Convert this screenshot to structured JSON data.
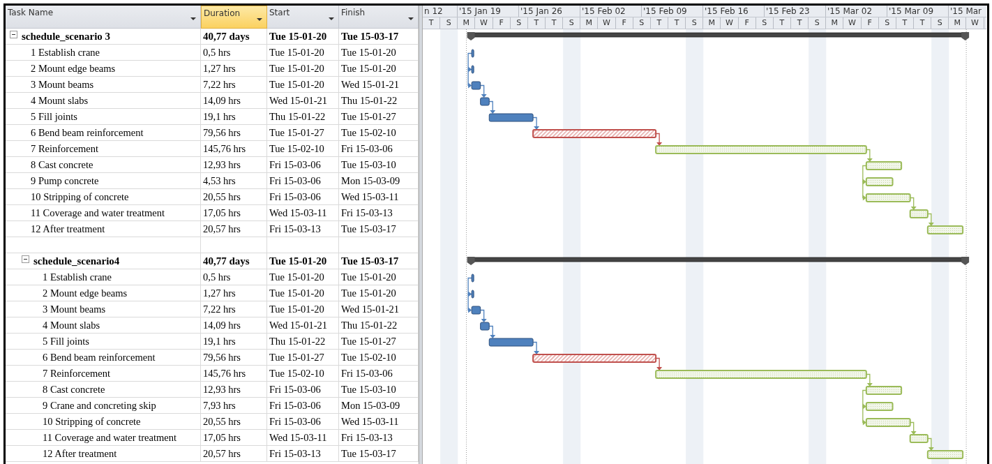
{
  "columns": [
    {
      "label": "Task Name",
      "selected": false
    },
    {
      "label": "Duration",
      "selected": true
    },
    {
      "label": "Start",
      "selected": false
    },
    {
      "label": "Finish",
      "selected": false
    }
  ],
  "timescale": {
    "weeks": [
      "n 12",
      "'15 Jan 19",
      "'15 Jan 26",
      "'15 Feb 02",
      "'15 Feb 09",
      "'15 Feb 16",
      "'15 Feb 23",
      "'15 Mar 02",
      "'15 Mar 09",
      "'15 Mar"
    ],
    "days": [
      "T",
      "S",
      "M",
      "W",
      "F",
      "S",
      "T",
      "T",
      "S",
      "M",
      "W",
      "F",
      "S",
      "T",
      "T",
      "S",
      "M",
      "W",
      "F",
      "S",
      "T",
      "T",
      "S",
      "M",
      "W",
      "F",
      "S",
      "T",
      "T",
      "S",
      "M",
      "W"
    ]
  },
  "groups": [
    {
      "name": "schedule_scenario 3",
      "expanded": true,
      "duration": "40,77 days",
      "start": "Tue 15-01-20",
      "finish": "Tue 15-03-17",
      "tasks": [
        {
          "name": "1 Establish crane",
          "duration": "0,5 hrs",
          "start": "Tue 15-01-20",
          "finish": "Tue 15-01-20",
          "kind": "solid",
          "color": "#4f81bd"
        },
        {
          "name": "2 Mount edge beams",
          "duration": "1,27 hrs",
          "start": "Tue 15-01-20",
          "finish": "Tue 15-01-20",
          "kind": "solid",
          "color": "#4f81bd"
        },
        {
          "name": "3 Mount beams",
          "duration": "7,22 hrs",
          "start": "Tue 15-01-20",
          "finish": "Wed 15-01-21",
          "kind": "solid",
          "color": "#4f81bd"
        },
        {
          "name": "4 Mount slabs",
          "duration": "14,09 hrs",
          "start": "Wed 15-01-21",
          "finish": "Thu 15-01-22",
          "kind": "solid",
          "color": "#4f81bd"
        },
        {
          "name": "5 Fill joints",
          "duration": "19,1 hrs",
          "start": "Thu 15-01-22",
          "finish": "Tue 15-01-27",
          "kind": "solid",
          "color": "#4f81bd"
        },
        {
          "name": "6 Bend beam reinforcement",
          "duration": "79,56 hrs",
          "start": "Tue 15-01-27",
          "finish": "Tue 15-02-10",
          "kind": "hatched",
          "color": "#c0504d"
        },
        {
          "name": "7 Reinforcement",
          "duration": "145,76 hrs",
          "start": "Tue 15-02-10",
          "finish": "Fri 15-03-06",
          "kind": "dotted",
          "color": "#9bbb59"
        },
        {
          "name": "8 Cast concrete",
          "duration": "12,93 hrs",
          "start": "Fri 15-03-06",
          "finish": "Tue 15-03-10",
          "kind": "dotted",
          "color": "#9bbb59"
        },
        {
          "name": "9 Pump concrete",
          "duration": "4,53 hrs",
          "start": "Fri 15-03-06",
          "finish": "Mon 15-03-09",
          "kind": "dotted",
          "color": "#9bbb59"
        },
        {
          "name": "10 Stripping of concrete",
          "duration": "20,55 hrs",
          "start": "Fri 15-03-06",
          "finish": "Wed 15-03-11",
          "kind": "dotted",
          "color": "#9bbb59"
        },
        {
          "name": "11 Coverage and water treatment",
          "duration": "17,05 hrs",
          "start": "Wed 15-03-11",
          "finish": "Fri 15-03-13",
          "kind": "dotted",
          "color": "#9bbb59"
        },
        {
          "name": "12 After treatment",
          "duration": "20,57 hrs",
          "start": "Fri 15-03-13",
          "finish": "Tue 15-03-17",
          "kind": "dotted",
          "color": "#9bbb59"
        }
      ]
    },
    {
      "name": "schedule_scenario4",
      "expanded": true,
      "duration": "40,77 days",
      "start": "Tue 15-01-20",
      "finish": "Tue 15-03-17",
      "tasks": [
        {
          "name": "1 Establish crane",
          "duration": "0,5 hrs",
          "start": "Tue 15-01-20",
          "finish": "Tue 15-01-20",
          "kind": "solid",
          "color": "#4f81bd"
        },
        {
          "name": "2 Mount edge beams",
          "duration": "1,27 hrs",
          "start": "Tue 15-01-20",
          "finish": "Tue 15-01-20",
          "kind": "solid",
          "color": "#4f81bd"
        },
        {
          "name": "3 Mount beams",
          "duration": "7,22 hrs",
          "start": "Tue 15-01-20",
          "finish": "Wed 15-01-21",
          "kind": "solid",
          "color": "#4f81bd"
        },
        {
          "name": "4 Mount slabs",
          "duration": "14,09 hrs",
          "start": "Wed 15-01-21",
          "finish": "Thu 15-01-22",
          "kind": "solid",
          "color": "#4f81bd"
        },
        {
          "name": "5 Fill joints",
          "duration": "19,1 hrs",
          "start": "Thu 15-01-22",
          "finish": "Tue 15-01-27",
          "kind": "solid",
          "color": "#4f81bd"
        },
        {
          "name": "6 Bend beam reinforcement",
          "duration": "79,56 hrs",
          "start": "Tue 15-01-27",
          "finish": "Tue 15-02-10",
          "kind": "hatched",
          "color": "#c0504d"
        },
        {
          "name": "7 Reinforcement",
          "duration": "145,76 hrs",
          "start": "Tue 15-02-10",
          "finish": "Fri 15-03-06",
          "kind": "dotted",
          "color": "#9bbb59"
        },
        {
          "name": "8 Cast concrete",
          "duration": "12,93 hrs",
          "start": "Fri 15-03-06",
          "finish": "Tue 15-03-10",
          "kind": "dotted",
          "color": "#9bbb59"
        },
        {
          "name": "9 Crane and concreting skip",
          "duration": "7,93 hrs",
          "start": "Fri 15-03-06",
          "finish": "Mon 15-03-09",
          "kind": "dotted",
          "color": "#9bbb59"
        },
        {
          "name": "10 Stripping of concrete",
          "duration": "20,55 hrs",
          "start": "Fri 15-03-06",
          "finish": "Wed 15-03-11",
          "kind": "dotted",
          "color": "#9bbb59"
        },
        {
          "name": "11 Coverage and water treatment",
          "duration": "17,05 hrs",
          "start": "Wed 15-03-11",
          "finish": "Fri 15-03-13",
          "kind": "dotted",
          "color": "#9bbb59"
        },
        {
          "name": "12 After treatment",
          "duration": "20,57 hrs",
          "start": "Fri 15-03-13",
          "finish": "Tue 15-03-17",
          "kind": "dotted",
          "color": "#9bbb59"
        }
      ]
    }
  ]
}
